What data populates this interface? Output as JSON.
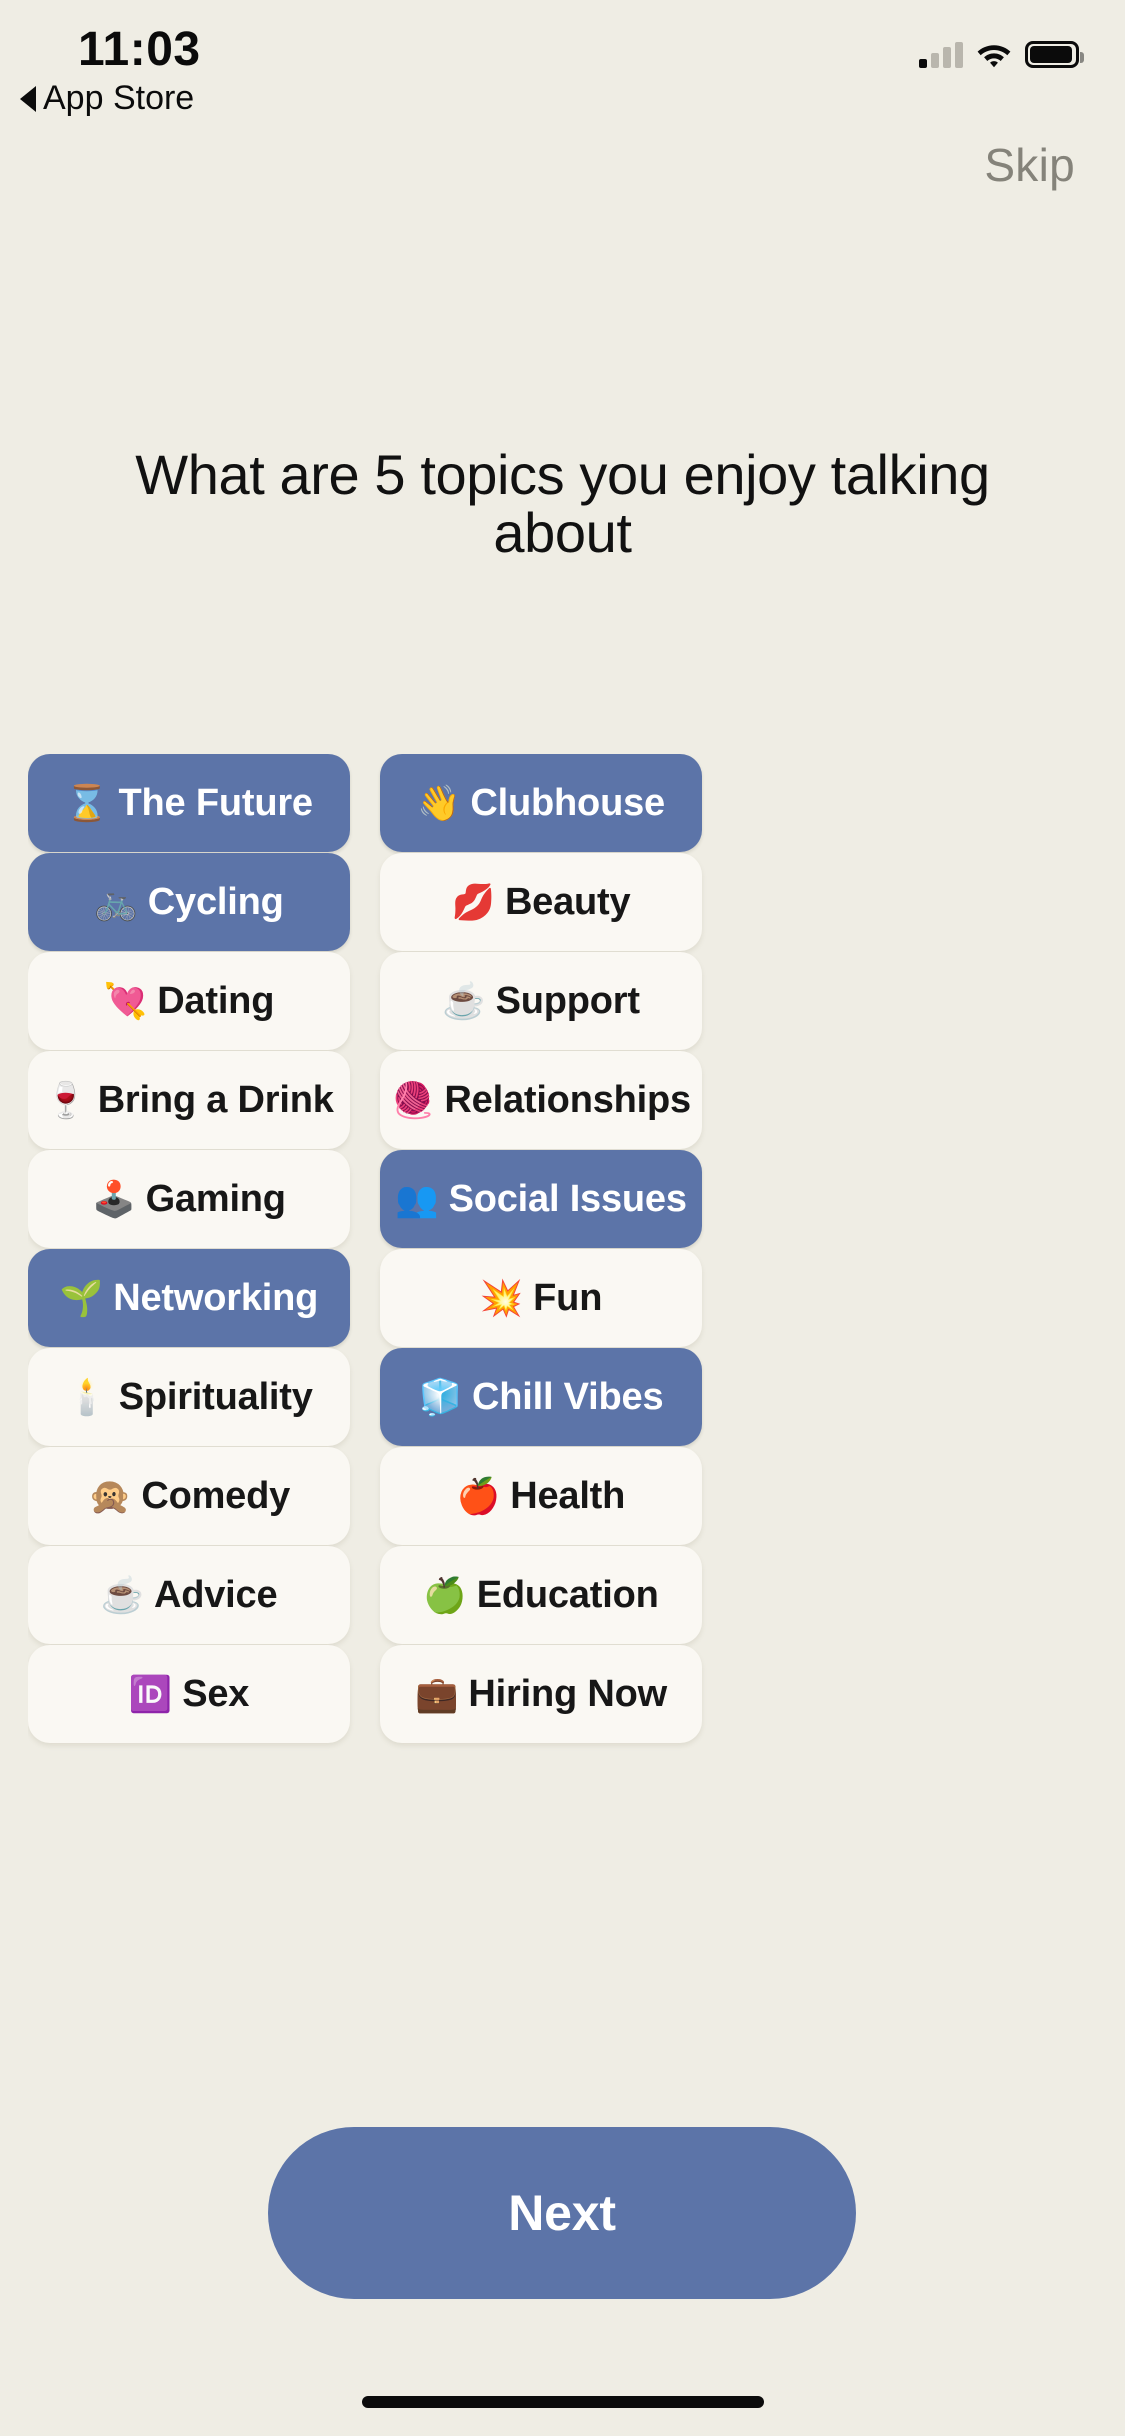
{
  "status_bar": {
    "time": "11:03",
    "back_label": "App Store",
    "back_icon": "triangle-left-icon",
    "signal_icon": "cellular-signal-icon",
    "signal_bars_filled": 1,
    "wifi_icon": "wifi-icon",
    "battery_icon": "battery-icon",
    "battery_level_pct": 92
  },
  "header": {
    "skip_label": "Skip",
    "title": "What are 5 topics you enjoy talking about"
  },
  "colors": {
    "background": "#EFEDE4",
    "accent": "#5C74A8",
    "chip_unselected_bg": "#FAF8F3",
    "chip_selected_text": "#FFFFFF",
    "chip_unselected_text": "#171717",
    "skip_text": "#85837A"
  },
  "topics": [
    {
      "label": "The Future",
      "emoji": "⌛",
      "icon": "hourglass-icon",
      "selected": true,
      "column": "left"
    },
    {
      "label": "Clubhouse",
      "emoji": "👋",
      "icon": "waving-hand-icon",
      "selected": true,
      "column": "right"
    },
    {
      "label": "Cycling",
      "emoji": "🚲",
      "icon": "bicycle-icon",
      "selected": true,
      "column": "left"
    },
    {
      "label": "Beauty",
      "emoji": "💋",
      "icon": "kiss-mark-icon",
      "selected": false,
      "column": "right"
    },
    {
      "label": "Dating",
      "emoji": "💘",
      "icon": "heart-with-arrow-icon",
      "selected": false,
      "column": "left"
    },
    {
      "label": "Support",
      "emoji": "☕",
      "icon": "hot-beverage-icon",
      "selected": false,
      "column": "right"
    },
    {
      "label": "Bring a Drink",
      "emoji": "🍷",
      "icon": "wine-glass-icon",
      "selected": false,
      "column": "left"
    },
    {
      "label": "Relationships",
      "emoji": "🧶",
      "icon": "yarn-ball-icon",
      "selected": false,
      "column": "right"
    },
    {
      "label": "Gaming",
      "emoji": "🕹️",
      "icon": "joystick-icon",
      "selected": false,
      "column": "left"
    },
    {
      "label": "Social Issues",
      "emoji": "👥",
      "icon": "two-people-icon",
      "selected": true,
      "column": "right"
    },
    {
      "label": "Networking",
      "emoji": "🌱",
      "icon": "seedling-icon",
      "selected": true,
      "column": "left"
    },
    {
      "label": "Fun",
      "emoji": "💥",
      "icon": "collision-icon",
      "selected": false,
      "column": "right"
    },
    {
      "label": "Spirituality",
      "emoji": "🕯️",
      "icon": "candle-icon",
      "selected": false,
      "column": "left"
    },
    {
      "label": "Chill Vibes",
      "emoji": "🧊",
      "icon": "ice-cube-icon",
      "selected": true,
      "column": "right"
    },
    {
      "label": "Comedy",
      "emoji": "🙊",
      "icon": "speak-no-evil-monkey-icon",
      "selected": false,
      "column": "left"
    },
    {
      "label": "Health",
      "emoji": "🍎",
      "icon": "red-apple-icon",
      "selected": false,
      "column": "right"
    },
    {
      "label": "Advice",
      "emoji": "☕",
      "icon": "hot-beverage-icon",
      "selected": false,
      "column": "left"
    },
    {
      "label": "Education",
      "emoji": "🍏",
      "icon": "green-apple-icon",
      "selected": false,
      "column": "right"
    },
    {
      "label": "Sex",
      "emoji": "🆔",
      "icon": "id-button-icon",
      "selected": false,
      "column": "left"
    },
    {
      "label": "Hiring Now",
      "emoji": "💼",
      "icon": "briefcase-icon",
      "selected": false,
      "column": "right"
    }
  ],
  "footer": {
    "next_label": "Next"
  }
}
